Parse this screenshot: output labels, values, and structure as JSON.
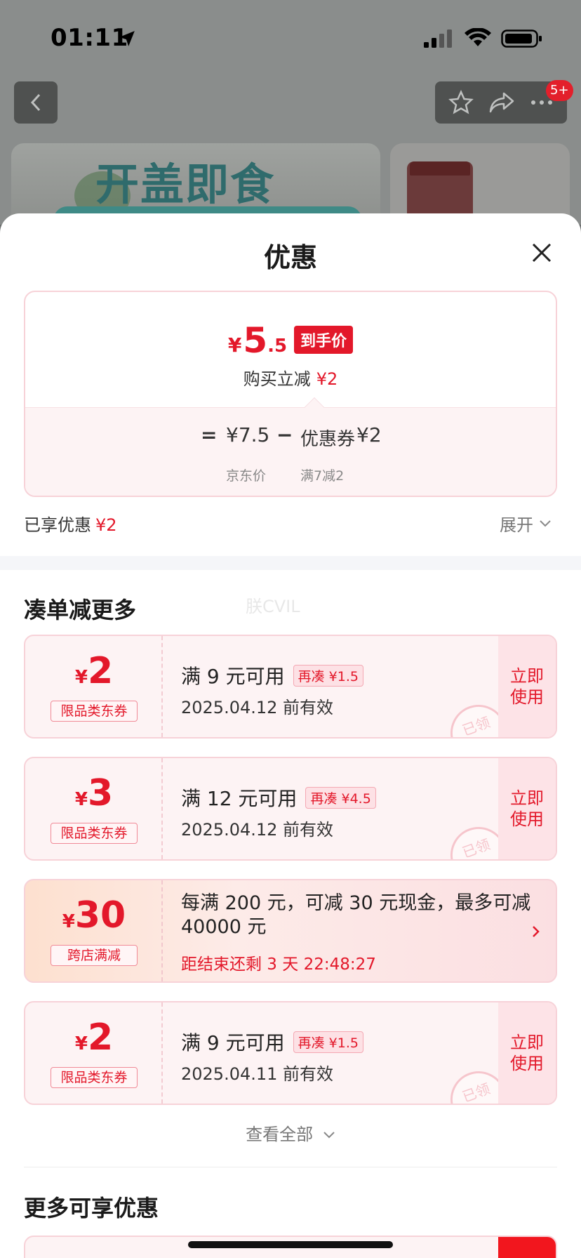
{
  "status_bar": {
    "time": "01:11",
    "icons": [
      "location-arrow-icon",
      "cellular-signal-icon",
      "wifi-icon",
      "battery-icon"
    ]
  },
  "nav": {
    "badge": "5+",
    "icons": [
      "back-chevron-icon",
      "star-icon",
      "share-icon",
      "more-icon"
    ]
  },
  "background": {
    "banner_title": "开盖即食"
  },
  "sheet": {
    "title": "优惠",
    "price": {
      "currency": "¥",
      "integer": "5",
      "decimal": ".5",
      "tag": "到手价",
      "reduce_label": "购买立减",
      "reduce_amount": "¥2",
      "eq": "=",
      "jd_price": "¥7.5",
      "minus": "−",
      "coupon_label": "优惠券",
      "coupon_value": "¥2",
      "jd_price_label": "京东价",
      "coupon_rule": "满7减2"
    },
    "enjoyed_label": "已享优惠",
    "enjoyed_amount": "¥2",
    "expand_label": "展开",
    "section_more": "凑单减更多",
    "watermark": "朕CVIL",
    "coupons": [
      {
        "currency": "¥",
        "amount": "2",
        "type": "限品类东券",
        "condition": "满 9 元可用",
        "more": "再凑 ¥1.5",
        "valid": "2025.04.12 前有效",
        "use": "立即使用",
        "stamp": "已领"
      },
      {
        "currency": "¥",
        "amount": "3",
        "type": "限品类东券",
        "condition": "满 12 元可用",
        "more": "再凑 ¥4.5",
        "valid": "2025.04.12 前有效",
        "use": "立即使用",
        "stamp": "已领"
      },
      {
        "currency": "¥",
        "amount": "30",
        "type": "跨店满减",
        "text": "每满 200 元，可减 30 元现金，最多可减 40000 元",
        "countdown": "距结束还剩 3 天 22:48:27"
      },
      {
        "currency": "¥",
        "amount": "2",
        "type": "限品类东券",
        "condition": "满 9 元可用",
        "more": "再凑 ¥1.5",
        "valid": "2025.04.11 前有效",
        "use": "立即使用",
        "stamp": "已领"
      }
    ],
    "view_all": "查看全部",
    "section_more_offers": "更多可享优惠"
  },
  "colors": {
    "accent_red": "#e3182a",
    "coupon_bg": "#fdf3f4",
    "coupon_border": "#f7d2d8"
  }
}
